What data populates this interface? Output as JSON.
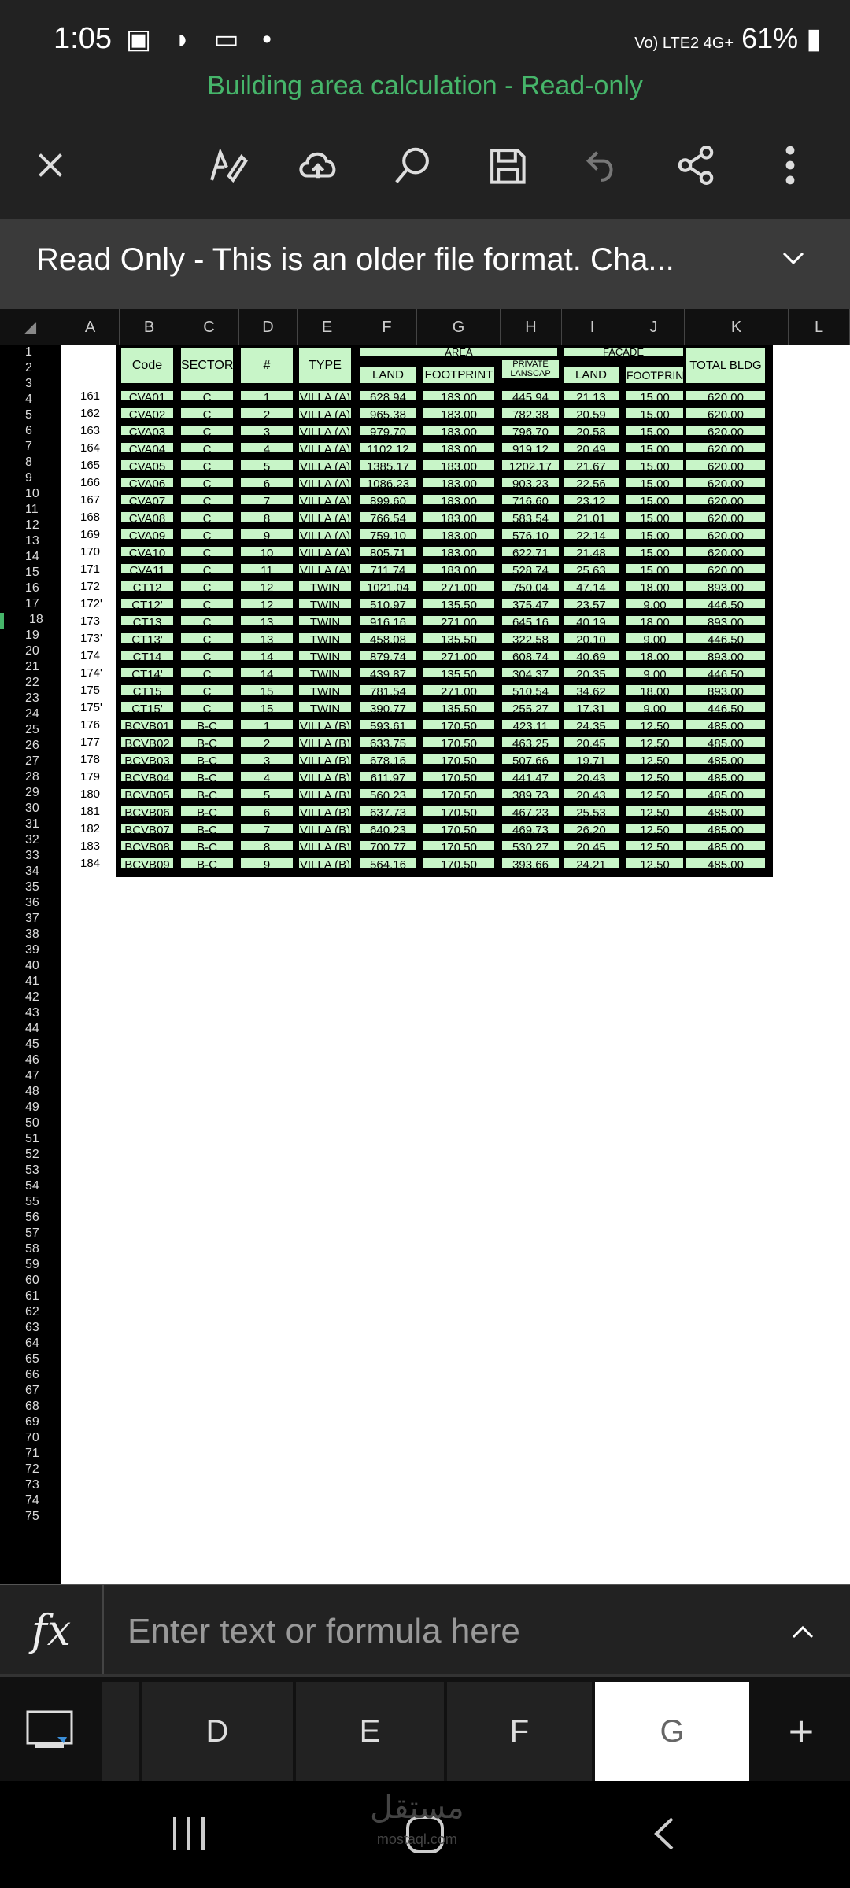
{
  "status": {
    "time": "1:05",
    "network": "Vo) LTE2 4G+",
    "battery": "61%"
  },
  "title": "Building area calculation - Read-only",
  "banner": {
    "message": "Read Only - This is an older file format. Cha..."
  },
  "columns": [
    "A",
    "B",
    "C",
    "D",
    "E",
    "F",
    "G",
    "H",
    "I",
    "J",
    "K",
    "L"
  ],
  "sheet": {
    "group_headers": {
      "area": "AREA",
      "facade": "FACADE"
    },
    "headers": {
      "code": "Code",
      "sector": "SECTOR",
      "num": "#",
      "type": "TYPE",
      "land": "LAND",
      "footprint": "FOOTPRINT",
      "private": "PRIVATE LANSCAP",
      "f_land": "LAND",
      "f_footprint": "FOOTPRIN",
      "total": "TOTAL BLDG"
    },
    "rows": [
      {
        "n": "3",
        "id": "161",
        "code": "CVA01",
        "sector": "C",
        "num": "1",
        "type": "VILLA (A)",
        "land": "628.94",
        "fp": "183.00",
        "pl": "445.94",
        "fl": "21.13",
        "ff": "15.00",
        "total": "620.00"
      },
      {
        "n": "4",
        "id": "162",
        "code": "CVA02",
        "sector": "C",
        "num": "2",
        "type": "VILLA (A)",
        "land": "965.38",
        "fp": "183.00",
        "pl": "782.38",
        "fl": "20.59",
        "ff": "15.00",
        "total": "620.00"
      },
      {
        "n": "5",
        "id": "163",
        "code": "CVA03",
        "sector": "C",
        "num": "3",
        "type": "VILLA (A)",
        "land": "979.70",
        "fp": "183.00",
        "pl": "796.70",
        "fl": "20.58",
        "ff": "15.00",
        "total": "620.00"
      },
      {
        "n": "6",
        "id": "164",
        "code": "CVA04",
        "sector": "C",
        "num": "4",
        "type": "VILLA (A)",
        "land": "1102.12",
        "fp": "183.00",
        "pl": "919.12",
        "fl": "20.49",
        "ff": "15.00",
        "total": "620.00"
      },
      {
        "n": "7",
        "id": "165",
        "code": "CVA05",
        "sector": "C",
        "num": "5",
        "type": "VILLA (A)",
        "land": "1385.17",
        "fp": "183.00",
        "pl": "1202.17",
        "fl": "21.67",
        "ff": "15.00",
        "total": "620.00"
      },
      {
        "n": "8",
        "id": "166",
        "code": "CVA06",
        "sector": "C",
        "num": "6",
        "type": "VILLA (A)",
        "land": "1086.23",
        "fp": "183.00",
        "pl": "903.23",
        "fl": "22.56",
        "ff": "15.00",
        "total": "620.00"
      },
      {
        "n": "9",
        "id": "167",
        "code": "CVA07",
        "sector": "C",
        "num": "7",
        "type": "VILLA (A)",
        "land": "899.60",
        "fp": "183.00",
        "pl": "716.60",
        "fl": "23.12",
        "ff": "15.00",
        "total": "620.00"
      },
      {
        "n": "10",
        "id": "168",
        "code": "CVA08",
        "sector": "C",
        "num": "8",
        "type": "VILLA (A)",
        "land": "766.54",
        "fp": "183.00",
        "pl": "583.54",
        "fl": "21.01",
        "ff": "15.00",
        "total": "620.00"
      },
      {
        "n": "11",
        "id": "169",
        "code": "CVA09",
        "sector": "C",
        "num": "9",
        "type": "VILLA (A)",
        "land": "759.10",
        "fp": "183.00",
        "pl": "576.10",
        "fl": "22.14",
        "ff": "15.00",
        "total": "620.00"
      },
      {
        "n": "12",
        "id": "170",
        "code": "CVA10",
        "sector": "C",
        "num": "10",
        "type": "VILLA (A)",
        "land": "805.71",
        "fp": "183.00",
        "pl": "622.71",
        "fl": "21.48",
        "ff": "15.00",
        "total": "620.00"
      },
      {
        "n": "13",
        "id": "171",
        "code": "CVA11",
        "sector": "C",
        "num": "11",
        "type": "VILLA (A)",
        "land": "711.74",
        "fp": "183.00",
        "pl": "528.74",
        "fl": "25.63",
        "ff": "15.00",
        "total": "620.00"
      },
      {
        "n": "14",
        "id": "172",
        "code": "CT12",
        "sector": "C",
        "num": "12",
        "type": "TWIN",
        "land": "1021.04",
        "fp": "271.00",
        "pl": "750.04",
        "fl": "47.14",
        "ff": "18.00",
        "total": "893.00"
      },
      {
        "n": "15",
        "id": "172'",
        "code": "CT12'",
        "sector": "C",
        "num": "12",
        "type": "TWIN",
        "land": "510.97",
        "fp": "135.50",
        "pl": "375.47",
        "fl": "23.57",
        "ff": "9.00",
        "total": "446.50"
      },
      {
        "n": "16",
        "id": "173",
        "code": "CT13",
        "sector": "C",
        "num": "13",
        "type": "TWIN",
        "land": "916.16",
        "fp": "271.00",
        "pl": "645.16",
        "fl": "40.19",
        "ff": "18.00",
        "total": "893.00"
      },
      {
        "n": "17",
        "id": "173'",
        "code": "CT13'",
        "sector": "C",
        "num": "13",
        "type": "TWIN",
        "land": "458.08",
        "fp": "135.50",
        "pl": "322.58",
        "fl": "20.10",
        "ff": "9.00",
        "total": "446.50"
      },
      {
        "n": "18",
        "id": "174",
        "code": "CT14",
        "sector": "C",
        "num": "14",
        "type": "TWIN",
        "land": "879.74",
        "fp": "271.00",
        "pl": "608.74",
        "fl": "40.69",
        "ff": "18.00",
        "total": "893.00"
      },
      {
        "n": "19",
        "id": "174'",
        "code": "CT14'",
        "sector": "C",
        "num": "14",
        "type": "TWIN",
        "land": "439.87",
        "fp": "135.50",
        "pl": "304.37",
        "fl": "20.35",
        "ff": "9.00",
        "total": "446.50"
      },
      {
        "n": "20",
        "id": "175",
        "code": "CT15",
        "sector": "C",
        "num": "15",
        "type": "TWIN",
        "land": "781.54",
        "fp": "271.00",
        "pl": "510.54",
        "fl": "34.62",
        "ff": "18.00",
        "total": "893.00"
      },
      {
        "n": "21",
        "id": "175'",
        "code": "CT15'",
        "sector": "C",
        "num": "15",
        "type": "TWIN",
        "land": "390.77",
        "fp": "135.50",
        "pl": "255.27",
        "fl": "17.31",
        "ff": "9.00",
        "total": "446.50"
      },
      {
        "n": "22",
        "id": "176",
        "code": "BCVB01",
        "sector": "B-C",
        "num": "1",
        "type": "VILLA (B)",
        "land": "593.61",
        "fp": "170.50",
        "pl": "423.11",
        "fl": "24.35",
        "ff": "12.50",
        "total": "485.00"
      },
      {
        "n": "23",
        "id": "177",
        "code": "BCVB02",
        "sector": "B-C",
        "num": "2",
        "type": "VILLA (B)",
        "land": "633.75",
        "fp": "170.50",
        "pl": "463.25",
        "fl": "20.45",
        "ff": "12.50",
        "total": "485.00"
      },
      {
        "n": "24",
        "id": "178",
        "code": "BCVB03",
        "sector": "B-C",
        "num": "3",
        "type": "VILLA (B)",
        "land": "678.16",
        "fp": "170.50",
        "pl": "507.66",
        "fl": "19.71",
        "ff": "12.50",
        "total": "485.00"
      },
      {
        "n": "25",
        "id": "179",
        "code": "BCVB04",
        "sector": "B-C",
        "num": "4",
        "type": "VILLA (B)",
        "land": "611.97",
        "fp": "170.50",
        "pl": "441.47",
        "fl": "20.43",
        "ff": "12.50",
        "total": "485.00"
      },
      {
        "n": "26",
        "id": "180",
        "code": "BCVB05",
        "sector": "B-C",
        "num": "5",
        "type": "VILLA (B)",
        "land": "560.23",
        "fp": "170.50",
        "pl": "389.73",
        "fl": "20.43",
        "ff": "12.50",
        "total": "485.00"
      },
      {
        "n": "27",
        "id": "181",
        "code": "BCVB06",
        "sector": "B-C",
        "num": "6",
        "type": "VILLA (B)",
        "land": "637.73",
        "fp": "170.50",
        "pl": "467.23",
        "fl": "25.53",
        "ff": "12.50",
        "total": "485.00"
      },
      {
        "n": "28",
        "id": "182",
        "code": "BCVB07",
        "sector": "B-C",
        "num": "7",
        "type": "VILLA (B)",
        "land": "640.23",
        "fp": "170.50",
        "pl": "469.73",
        "fl": "26.20",
        "ff": "12.50",
        "total": "485.00"
      },
      {
        "n": "29",
        "id": "183",
        "code": "BCVB08",
        "sector": "B-C",
        "num": "8",
        "type": "VILLA (B)",
        "land": "700.77",
        "fp": "170.50",
        "pl": "530.27",
        "fl": "20.45",
        "ff": "12.50",
        "total": "485.00"
      },
      {
        "n": "30",
        "id": "184",
        "code": "BCVB09",
        "sector": "B-C",
        "num": "9",
        "type": "VILLA (B)",
        "land": "564.16",
        "fp": "170.50",
        "pl": "393.66",
        "fl": "24.21",
        "ff": "12.50",
        "total": "485.00"
      }
    ]
  },
  "formula_bar": {
    "label": "fx",
    "placeholder": "Enter text or formula here"
  },
  "sheet_tabs": [
    "D",
    "E",
    "F",
    "G"
  ],
  "active_tab": "G",
  "add_tab": "+",
  "watermark": {
    "arabic": "مستقل",
    "latin": "mostaql.com"
  }
}
